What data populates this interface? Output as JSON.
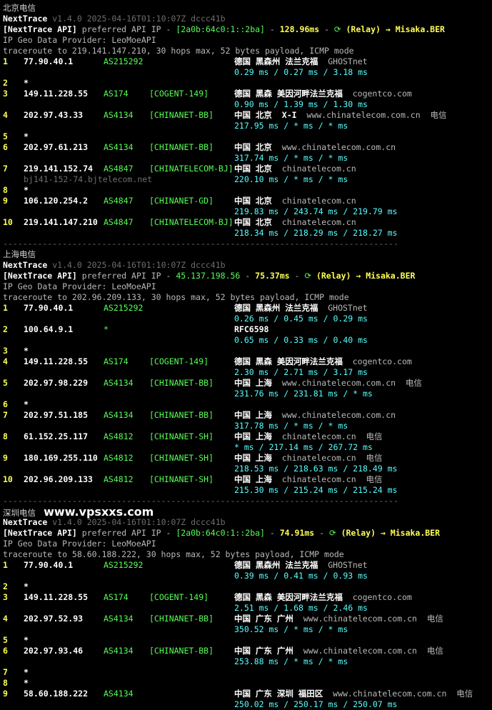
{
  "watermark": "www.vpsxxs.com",
  "sections": [
    {
      "title": "北京电信",
      "version": "v1.4.0 2025-04-16T01:10:07Z dccc41b",
      "api_ip": "[2a0b:64c0:1::2ba]",
      "api_latency": "128.96ms",
      "relay": "(Relay) → Misaka.BER",
      "provider": "IP Geo Data Provider: LeoMoeAPI",
      "trace": "traceroute to 219.141.147.210, 30 hops max, 52 bytes payload, ICMP mode",
      "hops": [
        {
          "n": "1",
          "ip": "77.90.40.1",
          "asn": "AS215292",
          "tag": "",
          "geo": "德国 黑森州 法兰克福",
          "host": "GHOSTnet",
          "isp": "",
          "rtt": "0.29 ms / 0.27 ms / 3.18 ms",
          "sub": ""
        },
        {
          "n": "2",
          "ip": "*",
          "asn": "",
          "tag": "",
          "geo": "",
          "host": "",
          "isp": "",
          "rtt": "",
          "sub": ""
        },
        {
          "n": "3",
          "ip": "149.11.228.55",
          "asn": "AS174",
          "tag": "[COGENT-149]",
          "geo": "德国 黑森 美因河畔法兰克福",
          "host": "cogentco.com",
          "isp": "",
          "rtt": "0.90 ms / 1.39 ms / 1.30 ms",
          "sub": ""
        },
        {
          "n": "4",
          "ip": "202.97.43.33",
          "asn": "AS4134",
          "tag": "[CHINANET-BB]",
          "geo": "中国 北京  X-I",
          "host": "www.chinatelecom.com.cn",
          "isp": "电信",
          "rtt": "217.95 ms / * ms / * ms",
          "sub": ""
        },
        {
          "n": "5",
          "ip": "*",
          "asn": "",
          "tag": "",
          "geo": "",
          "host": "",
          "isp": "",
          "rtt": "",
          "sub": ""
        },
        {
          "n": "6",
          "ip": "202.97.61.213",
          "asn": "AS4134",
          "tag": "[CHINANET-BB]",
          "geo": "中国 北京",
          "host": "www.chinatelecom.com.cn",
          "isp": "",
          "rtt": "317.74 ms / * ms / * ms",
          "sub": ""
        },
        {
          "n": "7",
          "ip": "219.141.152.74",
          "asn": "AS4847",
          "tag": "[CHINATELECOM-BJ]",
          "geo": "中国 北京",
          "host": "chinatelecom.cn",
          "isp": "",
          "rtt": "220.10 ms / * ms / * ms",
          "sub": "bj141-152-74.bjtelecom.net"
        },
        {
          "n": "8",
          "ip": "*",
          "asn": "",
          "tag": "",
          "geo": "",
          "host": "",
          "isp": "",
          "rtt": "",
          "sub": ""
        },
        {
          "n": "9",
          "ip": "106.120.254.2",
          "asn": "AS4847",
          "tag": "[CHINANET-GD]",
          "geo": "中国 北京",
          "host": "chinatelecom.cn",
          "isp": "",
          "rtt": "219.83 ms / 243.74 ms / 219.79 ms",
          "sub": ""
        },
        {
          "n": "10",
          "ip": "219.141.147.210",
          "asn": "AS4847",
          "tag": "[CHINATELECOM-BJ]",
          "geo": "中国 北京",
          "host": "chinatelecom.cn",
          "isp": "",
          "rtt": "218.34 ms / 218.29 ms / 218.27 ms",
          "sub": ""
        }
      ]
    },
    {
      "title": "上海电信",
      "version": "v1.4.0 2025-04-16T01:10:07Z dccc41b",
      "api_ip": "45.137.198.56",
      "api_latency": "75.37ms",
      "relay": "(Relay) → Misaka.BER",
      "provider": "IP Geo Data Provider: LeoMoeAPI",
      "trace": "traceroute to 202.96.209.133, 30 hops max, 52 bytes payload, ICMP mode",
      "hops": [
        {
          "n": "1",
          "ip": "77.90.40.1",
          "asn": "AS215292",
          "tag": "",
          "geo": "德国 黑森州 法兰克福",
          "host": "GHOSTnet",
          "isp": "",
          "rtt": "0.26 ms / 0.45 ms / 0.29 ms",
          "sub": ""
        },
        {
          "n": "2",
          "ip": "100.64.9.1",
          "asn": "*",
          "tag": "",
          "geo": "RFC6598",
          "host": "",
          "isp": "",
          "rtt": "0.65 ms / 0.33 ms / 0.40 ms",
          "sub": ""
        },
        {
          "n": "3",
          "ip": "*",
          "asn": "",
          "tag": "",
          "geo": "",
          "host": "",
          "isp": "",
          "rtt": "",
          "sub": ""
        },
        {
          "n": "4",
          "ip": "149.11.228.55",
          "asn": "AS174",
          "tag": "[COGENT-149]",
          "geo": "德国 黑森 美因河畔法兰克福",
          "host": "cogentco.com",
          "isp": "",
          "rtt": "2.30 ms / 2.71 ms / 3.17 ms",
          "sub": ""
        },
        {
          "n": "5",
          "ip": "202.97.98.229",
          "asn": "AS4134",
          "tag": "[CHINANET-BB]",
          "geo": "中国 上海",
          "host": "www.chinatelecom.com.cn",
          "isp": "电信",
          "rtt": "231.76 ms / 231.81 ms / * ms",
          "sub": ""
        },
        {
          "n": "6",
          "ip": "*",
          "asn": "",
          "tag": "",
          "geo": "",
          "host": "",
          "isp": "",
          "rtt": "",
          "sub": ""
        },
        {
          "n": "7",
          "ip": "202.97.51.185",
          "asn": "AS4134",
          "tag": "[CHINANET-BB]",
          "geo": "中国 上海",
          "host": "www.chinatelecom.com.cn",
          "isp": "",
          "rtt": "317.78 ms / * ms / * ms",
          "sub": ""
        },
        {
          "n": "8",
          "ip": "61.152.25.117",
          "asn": "AS4812",
          "tag": "[CHINANET-SH]",
          "geo": "中国 上海",
          "host": "chinatelecom.cn",
          "isp": "电信",
          "rtt": "* ms / 217.14 ms / 267.72 ms",
          "sub": ""
        },
        {
          "n": "9",
          "ip": "180.169.255.110",
          "asn": "AS4812",
          "tag": "[CHINANET-SH]",
          "geo": "中国 上海",
          "host": "chinatelecom.cn",
          "isp": "电信",
          "rtt": "218.53 ms / 218.63 ms / 218.49 ms",
          "sub": ""
        },
        {
          "n": "10",
          "ip": "202.96.209.133",
          "asn": "AS4812",
          "tag": "[CHINANET-SH]",
          "geo": "中国 上海",
          "host": "chinatelecom.cn",
          "isp": "电信",
          "rtt": "215.30 ms / 215.24 ms / 215.24 ms",
          "sub": ""
        }
      ]
    },
    {
      "title": "深圳电信",
      "version": "v1.4.0 2025-04-16T01:10:07Z dccc41b",
      "api_ip": "[2a0b:64c0:1::2ba]",
      "api_latency": "74.91ms",
      "relay": "(Relay) → Misaka.BER",
      "provider": "IP Geo Data Provider: LeoMoeAPI",
      "trace": "traceroute to 58.60.188.222, 30 hops max, 52 bytes payload, ICMP mode",
      "hops": [
        {
          "n": "1",
          "ip": "77.90.40.1",
          "asn": "AS215292",
          "tag": "",
          "geo": "德国 黑森州 法兰克福",
          "host": "GHOSTnet",
          "isp": "",
          "rtt": "0.39 ms / 0.41 ms / 0.93 ms",
          "sub": ""
        },
        {
          "n": "2",
          "ip": "*",
          "asn": "",
          "tag": "",
          "geo": "",
          "host": "",
          "isp": "",
          "rtt": "",
          "sub": ""
        },
        {
          "n": "3",
          "ip": "149.11.228.55",
          "asn": "AS174",
          "tag": "[COGENT-149]",
          "geo": "德国 黑森 美因河畔法兰克福",
          "host": "cogentco.com",
          "isp": "",
          "rtt": "2.51 ms / 1.68 ms / 2.46 ms",
          "sub": ""
        },
        {
          "n": "4",
          "ip": "202.97.52.93",
          "asn": "AS4134",
          "tag": "[CHINANET-BB]",
          "geo": "中国 广东 广州",
          "host": "www.chinatelecom.com.cn",
          "isp": "电信",
          "rtt": "350.52 ms / * ms / * ms",
          "sub": ""
        },
        {
          "n": "5",
          "ip": "*",
          "asn": "",
          "tag": "",
          "geo": "",
          "host": "",
          "isp": "",
          "rtt": "",
          "sub": ""
        },
        {
          "n": "6",
          "ip": "202.97.93.46",
          "asn": "AS4134",
          "tag": "[CHINANET-BB]",
          "geo": "中国 广东 广州",
          "host": "www.chinatelecom.com.cn",
          "isp": "电信",
          "rtt": "253.88 ms / * ms / * ms",
          "sub": ""
        },
        {
          "n": "7",
          "ip": "*",
          "asn": "",
          "tag": "",
          "geo": "",
          "host": "",
          "isp": "",
          "rtt": "",
          "sub": ""
        },
        {
          "n": "8",
          "ip": "*",
          "asn": "",
          "tag": "",
          "geo": "",
          "host": "",
          "isp": "",
          "rtt": "",
          "sub": ""
        },
        {
          "n": "9",
          "ip": "58.60.188.222",
          "asn": "AS4134",
          "tag": "",
          "geo": "中国 广东 深圳 福田区",
          "host": "www.chinatelecom.com.cn",
          "isp": "电信",
          "rtt": "250.02 ms / 250.17 ms / 250.07 ms",
          "sub": ""
        }
      ]
    }
  ]
}
